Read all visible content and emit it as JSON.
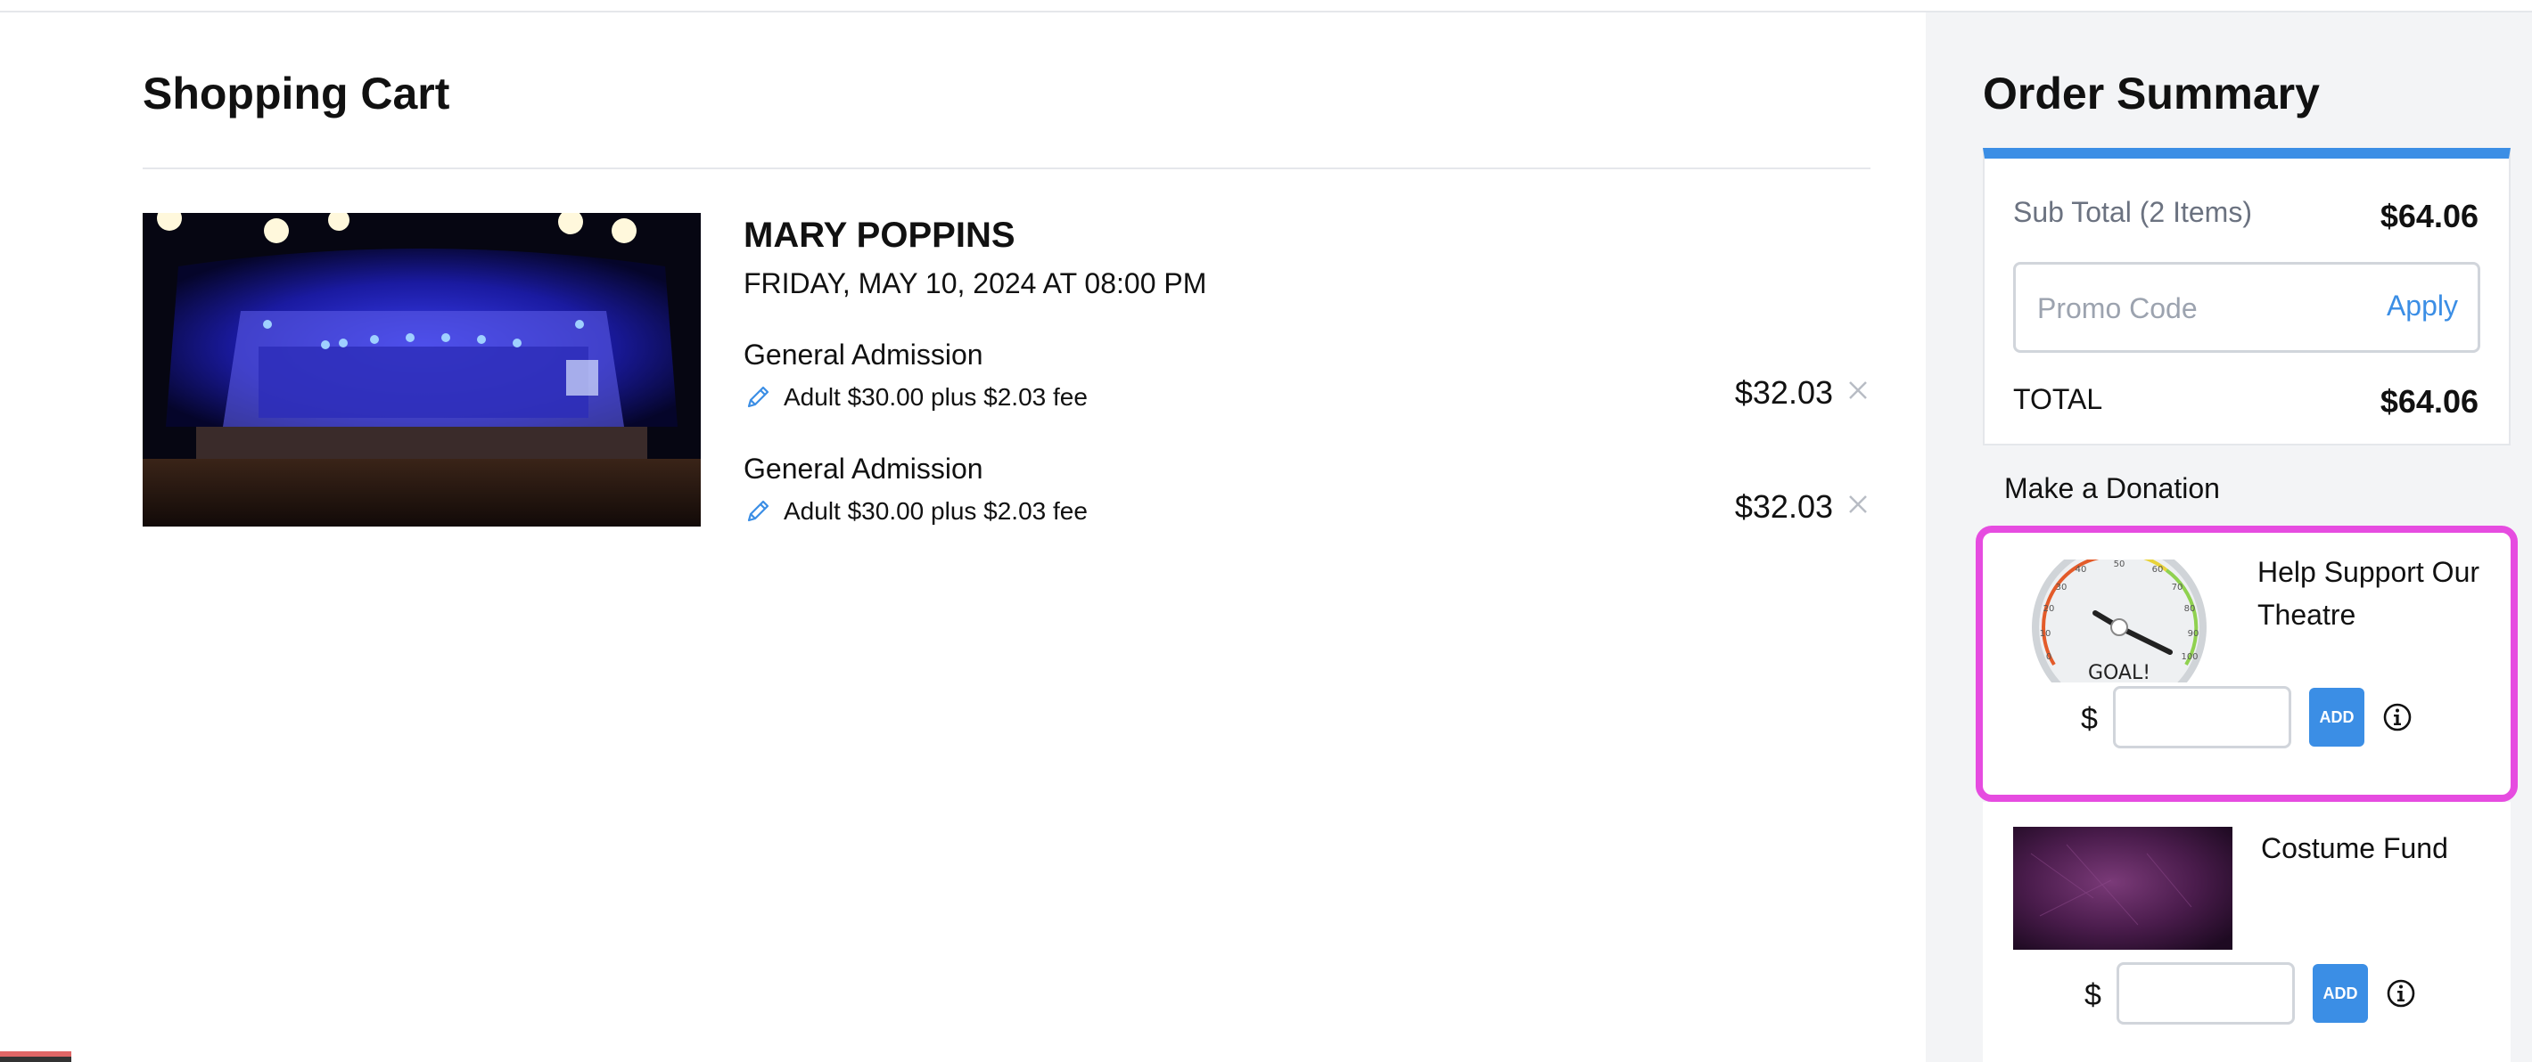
{
  "cart": {
    "title": "Shopping Cart",
    "event": {
      "name": "MARY POPPINS",
      "date": "FRIDAY, MAY 10, 2024 AT 08:00 PM",
      "lines": [
        {
          "type": "General Admission",
          "desc": "Adult $30.00 plus $2.03 fee",
          "price": "$32.03"
        },
        {
          "type": "General Admission",
          "desc": "Adult $30.00 plus $2.03 fee",
          "price": "$32.03"
        }
      ]
    }
  },
  "summary": {
    "title": "Order Summary",
    "subtotal_label": "Sub Total (2 Items)",
    "subtotal_value": "$64.06",
    "promo_placeholder": "Promo Code",
    "apply_label": "Apply",
    "total_label": "TOTAL",
    "total_value": "$64.06",
    "accent_color": "#3b8ee5"
  },
  "donation": {
    "label": "Make a Donation",
    "currency": "$",
    "add_label": "ADD",
    "funds": [
      {
        "name": "Help Support Our Theatre",
        "image_caption": "GOAL!",
        "highlighted": true
      },
      {
        "name": "Costume Fund",
        "highlighted": false
      }
    ],
    "highlight_color": "#e64ce0"
  },
  "gauge_ticks": [
    "0",
    "10",
    "20",
    "30",
    "40",
    "50",
    "60",
    "70",
    "80",
    "90",
    "100"
  ]
}
